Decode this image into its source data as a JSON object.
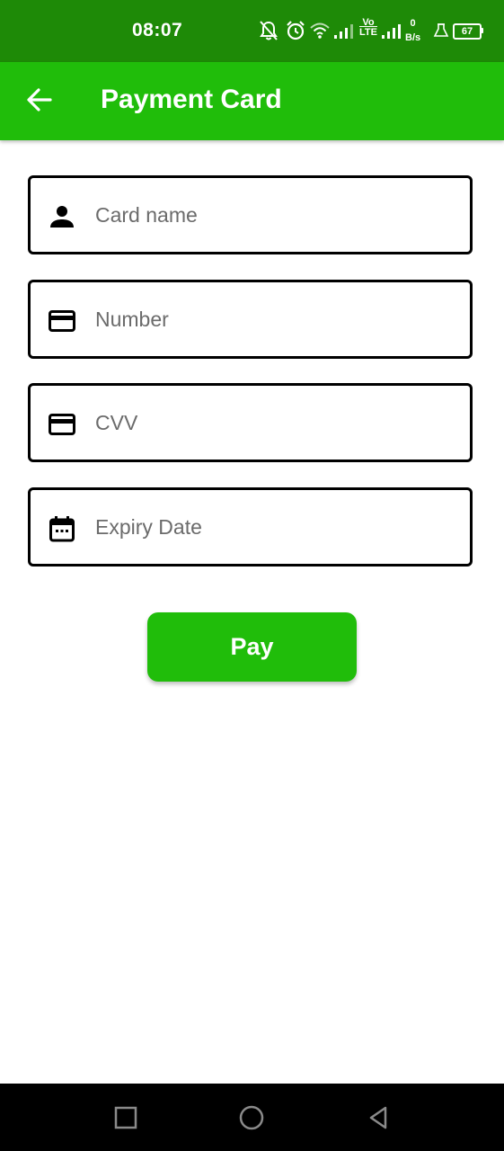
{
  "status_bar": {
    "time": "08:07",
    "network_type": [
      "Vo",
      "LTE"
    ],
    "net_speed": [
      "0",
      "B/s"
    ],
    "battery_level": "67",
    "icons": [
      "mute-notifications-icon",
      "alarm-icon",
      "wifi-icon",
      "signal-icon",
      "signal-icon",
      "data-saver-icon",
      "battery-icon"
    ]
  },
  "app_bar": {
    "title": "Payment Card",
    "back_icon": "arrow-back-icon",
    "color": "#20bd0a"
  },
  "form": {
    "fields": [
      {
        "placeholder": "Card name",
        "value": "",
        "icon": "person-icon"
      },
      {
        "placeholder": "Number",
        "value": "",
        "icon": "credit-card-icon"
      },
      {
        "placeholder": "CVV",
        "value": "",
        "icon": "credit-card-icon"
      },
      {
        "placeholder": "Expiry Date",
        "value": "",
        "icon": "calendar-icon"
      }
    ],
    "pay_label": "Pay"
  },
  "nav_bar": {
    "buttons": [
      "recents-square-icon",
      "home-circle-icon",
      "back-triangle-icon"
    ]
  },
  "colors": {
    "status_bar": "#1e8a07",
    "accent": "#20bd0a",
    "field_border": "#000000"
  }
}
